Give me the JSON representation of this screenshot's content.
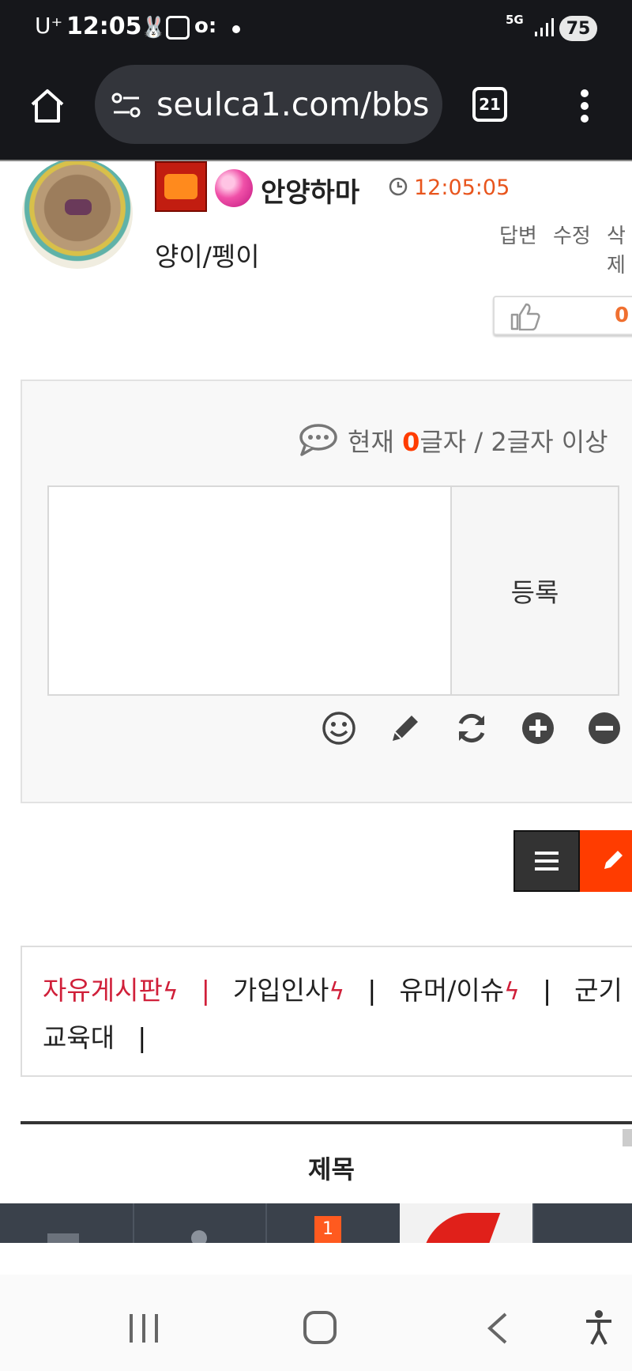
{
  "status_bar": {
    "carrier": "U⁺",
    "time": "12:05",
    "network": "5G",
    "battery": "75"
  },
  "browser": {
    "url": "seulca1.com/bbs",
    "tab_count": "21"
  },
  "comment": {
    "author": "안양하마",
    "time": "12:05:05",
    "text": "양이/펭이",
    "actions": [
      "답변",
      "수정",
      "삭제"
    ],
    "like_count": "0"
  },
  "comment_form": {
    "counter_prefix": "현재 ",
    "counter_value": "0",
    "counter_suffix": "글자 / 2글자 이상",
    "submit_label": "등록"
  },
  "categories": [
    {
      "label": "자유게시판",
      "active": true,
      "hot": true
    },
    {
      "label": "가입인사",
      "active": false,
      "hot": true
    },
    {
      "label": "유머/이슈",
      "active": false,
      "hot": true
    },
    {
      "label": "군기교육대",
      "active": false,
      "hot": false
    }
  ],
  "list": {
    "column_title": "제목",
    "bottom_badge": "1"
  },
  "colors": {
    "accent": "#ff3c00",
    "category_active": "#d0203a",
    "time": "#e8551d",
    "dark_bar": "#16171b"
  }
}
